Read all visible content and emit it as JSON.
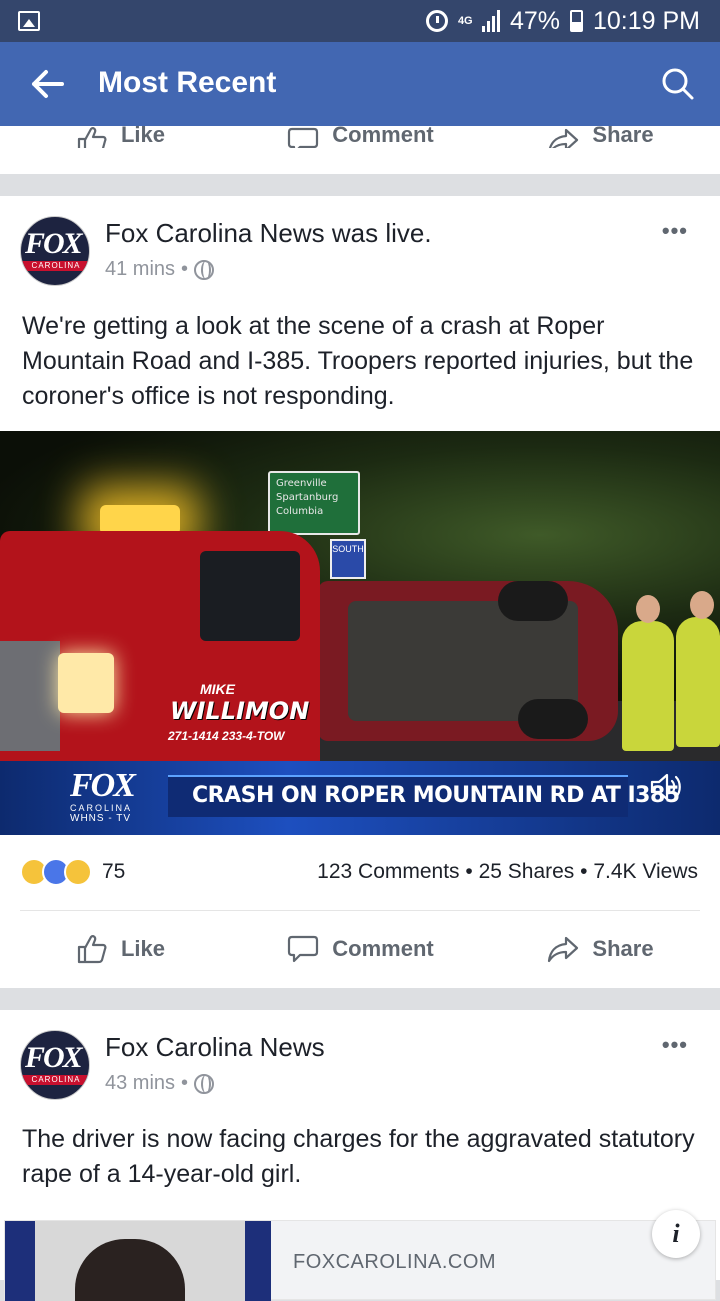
{
  "status_bar": {
    "network": "4G",
    "battery": "47%",
    "time": "10:19 PM"
  },
  "app_bar": {
    "title": "Most Recent"
  },
  "actions": {
    "like": "Like",
    "comment": "Comment",
    "share": "Share"
  },
  "posts": [
    {
      "author": "Fox Carolina News was live.",
      "time": "41 mins",
      "text": "We're getting a look at the scene of a crash at Roper Mountain Road and I-385. Troopers reported injuries, but the coroner's office is not responding.",
      "video": {
        "headline": "CRASH ON ROPER MOUNTAIN RD AT I385",
        "logo": "FOX",
        "logo_sub1": "CAROLINA",
        "logo_sub2": "WHNS - TV",
        "sign_lines": [
          "Greenville",
          "Spartanburg",
          "Columbia"
        ],
        "shield_text": "SOUTH",
        "truck_brand_small": "MIKE",
        "truck_brand": "WILLIMON",
        "truck_phone": "271-1414  233-4-TOW"
      },
      "reaction_count": "75",
      "engagement": "123 Comments • 25 Shares • 7.4K Views"
    },
    {
      "author": "Fox Carolina News",
      "time": "43 mins",
      "text": "The driver is now facing charges for the aggravated statutory rape of a 14-year-old girl.",
      "link_domain": "FOXCAROLINA.COM",
      "info_icon_label": "i"
    }
  ],
  "avatar": {
    "word": "FOX",
    "sub": "CAROLINA"
  },
  "colors": {
    "status_bar": "#34466c",
    "app_bar": "#4267b2",
    "text_secondary": "#90949c"
  }
}
